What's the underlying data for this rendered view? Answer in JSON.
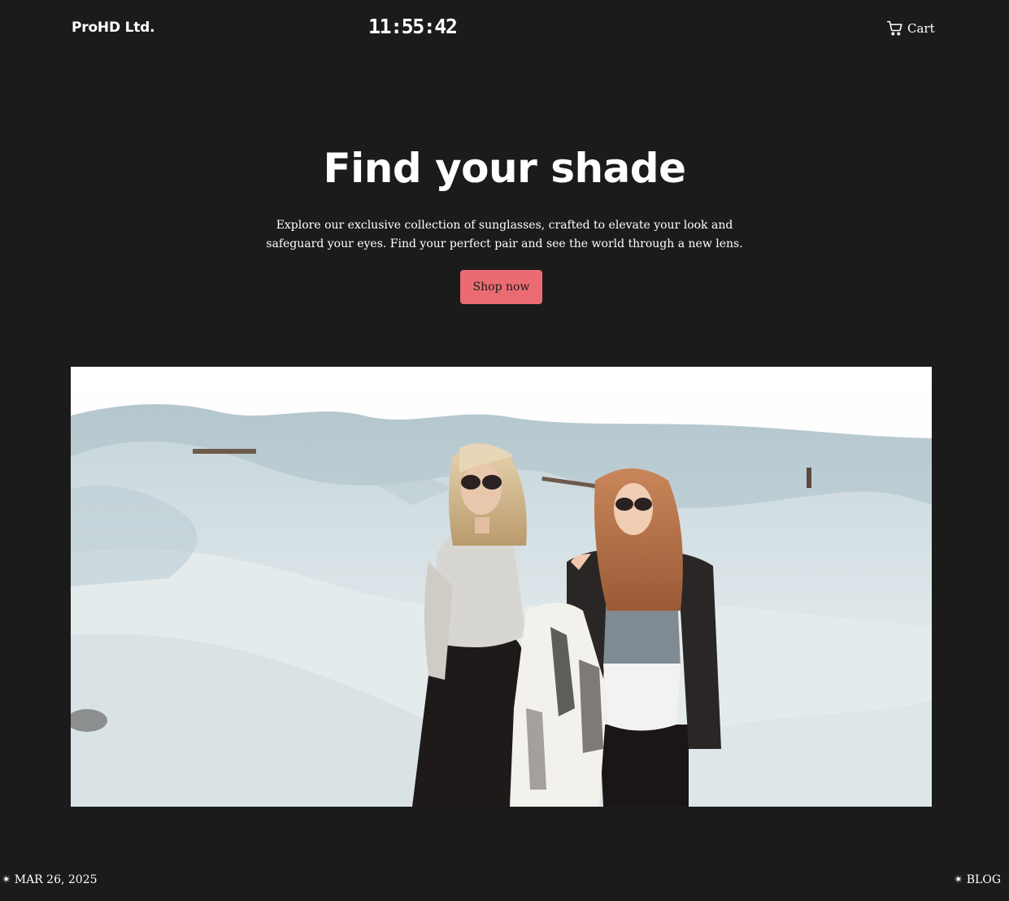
{
  "header": {
    "brand": "ProHD Ltd.",
    "clock": "11:55:42",
    "cart_label": "Cart",
    "cart_icon": "shopping-cart-icon"
  },
  "hero": {
    "title": "Find your shade",
    "description": "Explore our exclusive collection of sunglasses, crafted to elevate your look and safeguard your eyes. Find your perfect pair and see the world through a new lens.",
    "button_label": "Shop now",
    "image_description": "Photo: two women wearing sunglasses walking on white sand dunes"
  },
  "footer": {
    "date": "MAR 26, 2025",
    "blog_label": "BLOG",
    "star_icon": "✴"
  },
  "colors": {
    "background": "#1b1b1b",
    "text": "#ffffff",
    "accent": "#ea6c72"
  }
}
